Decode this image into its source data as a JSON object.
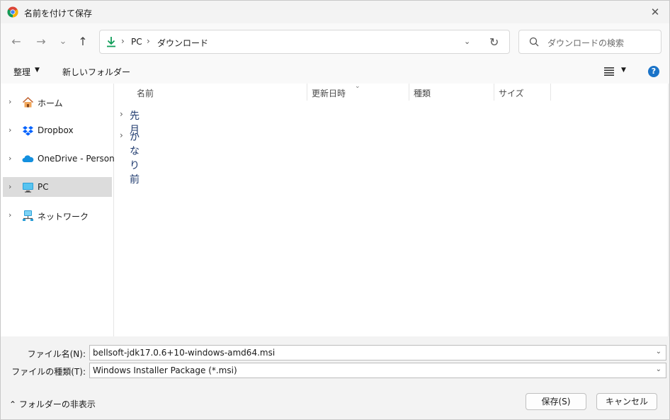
{
  "window": {
    "title": "名前を付けて保存"
  },
  "nav": {
    "back": "←",
    "forward": "→",
    "recent": "⌄",
    "up": "↑"
  },
  "address": {
    "crumbs": [
      "PC",
      "ダウンロード"
    ],
    "separator": "›"
  },
  "search": {
    "placeholder": "ダウンロードの検索"
  },
  "toolbar": {
    "organize": "整理",
    "new_folder": "新しいフォルダー"
  },
  "sidebar": {
    "items": [
      {
        "label": "ホーム",
        "icon": "home-icon"
      },
      {
        "label": "Dropbox",
        "icon": "dropbox-icon"
      },
      {
        "label": "OneDrive - Personal",
        "icon": "onedrive-icon"
      },
      {
        "label": "PC",
        "icon": "pc-icon",
        "selected": true
      },
      {
        "label": "ネットワーク",
        "icon": "network-icon"
      }
    ]
  },
  "columns": [
    "名前",
    "更新日時",
    "種類",
    "サイズ"
  ],
  "groups": [
    "先月",
    "かなり前"
  ],
  "form": {
    "filename_label": "ファイル名(N):",
    "filename_value": "bellsoft-jdk17.0.6+10-windows-amd64.msi",
    "filetype_label": "ファイルの種類(T):",
    "filetype_value": "Windows Installer Package (*.msi)"
  },
  "footer": {
    "hide_folders": "フォルダーの非表示",
    "save_label": "保存(S)",
    "cancel_label": "キャンセル"
  },
  "colors": {
    "accent": "#0f9d58",
    "help": "#1a73c8",
    "selected": "#dcdcdc"
  }
}
